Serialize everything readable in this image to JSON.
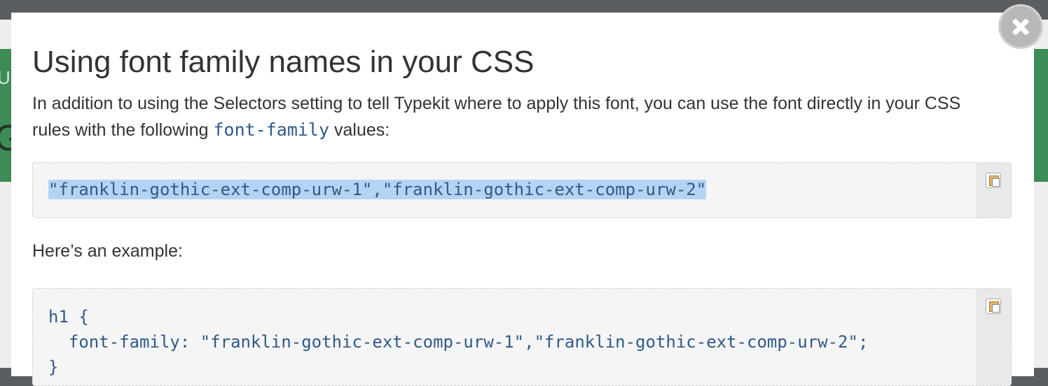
{
  "modal": {
    "title": "Using font family names in your CSS",
    "intro_before": "In addition to using the Selectors setting to tell Typekit where to apply this font, you can use the font directly in your CSS rules with the following ",
    "intro_code": "font-family",
    "intro_after": " values:",
    "font_family_values": "\"franklin-gothic-ext-comp-urw-1\",\"franklin-gothic-ext-comp-urw-2\"",
    "example_label": "Here’s an example:",
    "example_code": {
      "line1": "h1 {",
      "line2": "  font-family: \"franklin-gothic-ext-comp-urw-1\",\"franklin-gothic-ext-comp-urw-2\";",
      "line3": "}"
    }
  },
  "background": {
    "glyph_top": "U",
    "glyph_bottom": "G"
  },
  "icons": {
    "close": "close-icon",
    "copy": "copy-to-clipboard-icon"
  },
  "colors": {
    "code_text": "#2f5a8a",
    "selection": "#b5d3f3",
    "band": "#3d8b57"
  }
}
